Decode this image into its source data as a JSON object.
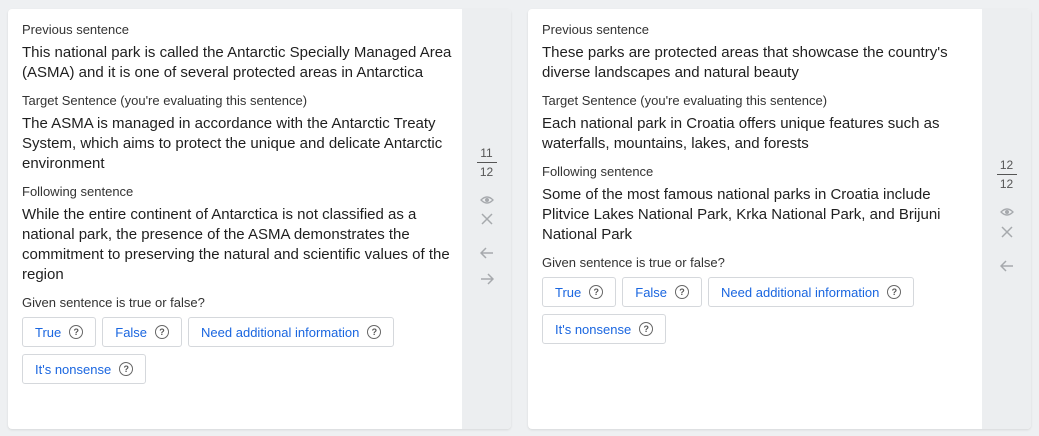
{
  "tasks": [
    {
      "previous_label": "Previous sentence",
      "previous_text": "This national park is called the Antarctic Specially Managed Area (ASMA) and it is one of several protected areas in Antarctica",
      "target_label": "Target Sentence (you're evaluating this sentence)",
      "target_text": "The ASMA is managed in accordance with the Antarctic Treaty System, which aims to protect the unique and delicate Antarctic environment",
      "following_label": "Following sentence",
      "following_text": "While the entire continent of Antarctica is not classified as a national park, the presence of the ASMA demonstrates the commitment to preserving the natural and scientific values of the region",
      "question": "Given sentence is true or false?",
      "answers": [
        "True",
        "False",
        "Need additional information",
        "It's nonsense"
      ],
      "counter": {
        "current": "11",
        "total": "12"
      },
      "icons": [
        "eye-icon",
        "close-icon",
        "arrow-left-icon",
        "arrow-right-icon"
      ]
    },
    {
      "previous_label": "Previous sentence",
      "previous_text": "These parks are protected areas that showcase the country's diverse landscapes and natural beauty",
      "target_label": "Target Sentence (you're evaluating this sentence)",
      "target_text": "Each national park in Croatia offers unique features such as waterfalls, mountains, lakes, and forests",
      "following_label": "Following sentence",
      "following_text": "Some of the most famous national parks in Croatia include Plitvice Lakes National Park, Krka National Park, and Brijuni National Park",
      "question": "Given sentence is true or false?",
      "answers": [
        "True",
        "False",
        "Need additional information",
        "It's nonsense"
      ],
      "counter": {
        "current": "12",
        "total": "12"
      },
      "icons": [
        "eye-icon",
        "close-icon",
        "arrow-left-icon"
      ]
    }
  ],
  "help_glyph": "?",
  "colors": {
    "background": "#eef0f2",
    "card": "#ffffff",
    "sidebar": "#eceef0",
    "accent": "#1a66e0",
    "border": "#d5d8dc"
  }
}
